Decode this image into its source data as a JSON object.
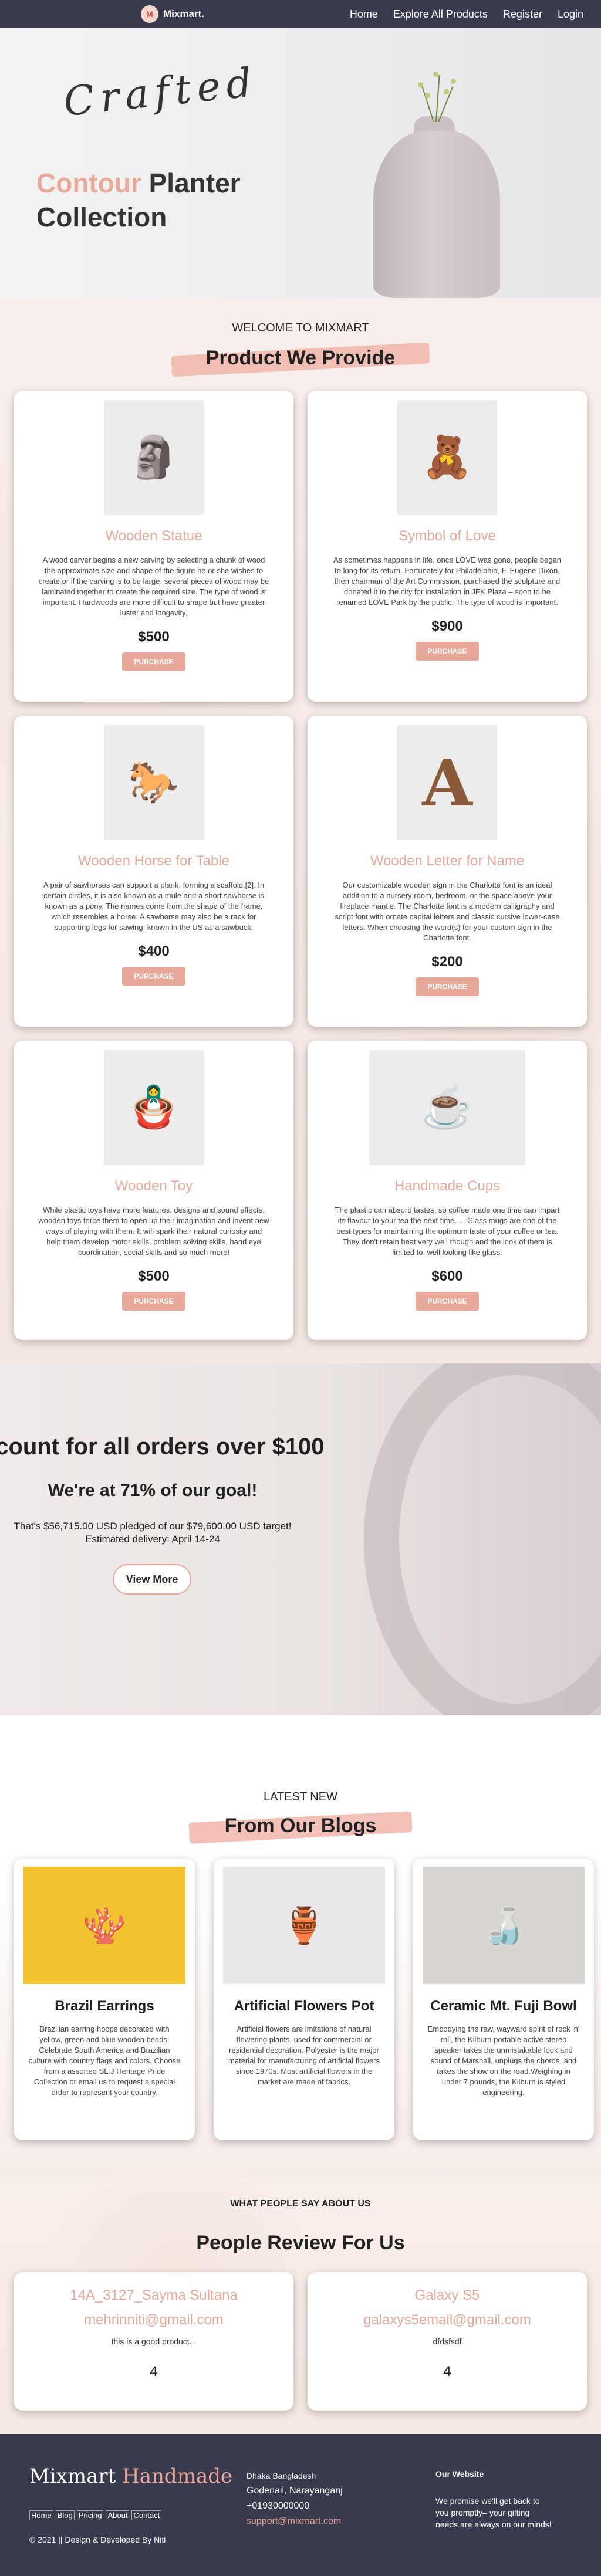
{
  "nav": {
    "brand": "Mixmart.",
    "links": [
      "Home",
      "Explore All Products",
      "Register",
      "Login"
    ]
  },
  "hero": {
    "script_word": "Crafted",
    "title_accent": "Contour",
    "title_rest": " Planter",
    "title_line2": "Collection"
  },
  "products": {
    "kicker": "WELCOME TO MIXMART",
    "title": "Product We Provide",
    "button_label": "PURCHASE",
    "items": [
      {
        "name": "Wooden Statue",
        "desc": "A wood carver begins a new carving by selecting a chunk of wood the approximate size and shape of the figure he or she wishes to create or if the carving is to be large, several pieces of wood may be laminated together to create the required size. The type of wood is important. Hardwoods are more difficult to shape but have greater luster and longevity.",
        "price": "$500",
        "icon": "statue-icon"
      },
      {
        "name": "Symbol of Love",
        "desc": "As sometimes happens in life, once LOVE was gone, people began to long for its return. Fortunately for Philadelphia, F. Eugene Dixon, then chairman of the Art Commission, purchased the sculpture and donated it to the city for installation in JFK Plaza – soon to be renamed LOVE Park by the public. The type of wood is important.",
        "price": "$900",
        "icon": "figurine-icon"
      },
      {
        "name": "Wooden Horse for Table",
        "desc": "A pair of sawhorses can support a plank, forming a scaffold.[2]. In certain circles, it is also known as a mule and a short sawhorse is known as a pony. The names come from the shape of the frame, which resembles a horse. A sawhorse may also be a rack for supporting logs for sawing, known in the US as a sawbuck.",
        "price": "$400",
        "icon": "horse-icon"
      },
      {
        "name": "Wooden Letter for Name",
        "desc": "Our customizable wooden sign in the Charlotte font is an ideal addition to a nursery room, bedroom, or the space above your fireplace mantle. The Charlotte font is a modern calligraphy and script font with ornate capital letters and classic cursive lower-case letters. When choosing the word(s) for your custom sign in the Charlotte font.",
        "price": "$200",
        "icon": "letter-a-icon"
      },
      {
        "name": "Wooden Toy",
        "desc": "While plastic toys have more features, designs and sound effects, wooden toys force them to open up their imagination and invent new ways of playing with them. It will spark their natural curiosity and help them develop motor skills, problem solving skills, hand eye coordination, social skills and so much more!",
        "price": "$500",
        "icon": "toy-icon"
      },
      {
        "name": "Handmade Cups",
        "desc": "The plastic can absorb tastes, so coffee made one time can impart its flavour to your tea the next time. ... Glass mugs are one of the best types for maintaining the optimum taste of your coffee or tea. They don't retain heat very well though and the look of them is limited to, well looking like glass.",
        "price": "$600",
        "icon": "cup-icon"
      }
    ]
  },
  "discount": {
    "headline": "scount for all orders over $100",
    "goal": "We're at 71% of our goal!",
    "pledged": "That's $56,715.00 USD pledged of our $79,600.00 USD target!",
    "delivery": "Estimated delivery: April 14-24",
    "button": "View More"
  },
  "blogs": {
    "kicker": "LATEST NEW",
    "title": "From Our Blogs",
    "items": [
      {
        "title": "Brazil Earrings",
        "text": "Brazilian earring hoops decorated with yellow, green and blue wooden beads. Celebrate South America and Brazilian culture with country flags and colors. Choose from a assorted SL.J Heritage Pride Collection or email us to request a special order to represent your country.",
        "icon": "earrings-icon"
      },
      {
        "title": "Artificial Flowers Pot",
        "text": "Artificial flowers are imitations of natural flowering plants, used for commercial or residential decoration. Polyester is the major material for manufacturing of artificial flowers since 1970s. Most artificial flowers in the market are made of fabrics.",
        "icon": "vase-icon"
      },
      {
        "title": "Ceramic Mt. Fuji Bowl",
        "text": "Embodying the raw, wayward spirit of rock 'n' roll, the Kilburn portable active stereo speaker takes the unmistakable look and sound of Marshall, unplugs the chords, and takes the show on the road.Weighing in under 7 pounds, the Kilburn is styled engineering.",
        "icon": "bowl-icon"
      }
    ]
  },
  "reviews": {
    "kicker": "WHAT PEOPLE SAY ABOUT US",
    "title": "People Review For Us",
    "items": [
      {
        "name": "14A_3127_Sayma Sultana",
        "email": "mehrinniti@gmail.com",
        "text": "this is a good product...",
        "rating": "4"
      },
      {
        "name": "Galaxy S5",
        "email": "galaxys5email@gmail.com",
        "text": "dfdsfsdf",
        "rating": "4"
      }
    ]
  },
  "footer": {
    "brand": "Mixmart",
    "brand_accent": " Handmade",
    "links": [
      "Home",
      "Blog",
      "Pricing",
      "About",
      "Contact"
    ],
    "copyright": "© 2021 || Design & Developed By Niti",
    "address_line1": "Dhaka Bangladesh",
    "address_line2": "Godenail, Narayanganj",
    "phone": "+01930000000",
    "email": "support@mixmart.com",
    "about_title": "Our Website",
    "about_text": "We promise we'll get back to you promptly– your gifting needs are always on our minds!"
  },
  "colors": {
    "accent": "#e8a99a",
    "dark": "#3a3a4e"
  }
}
